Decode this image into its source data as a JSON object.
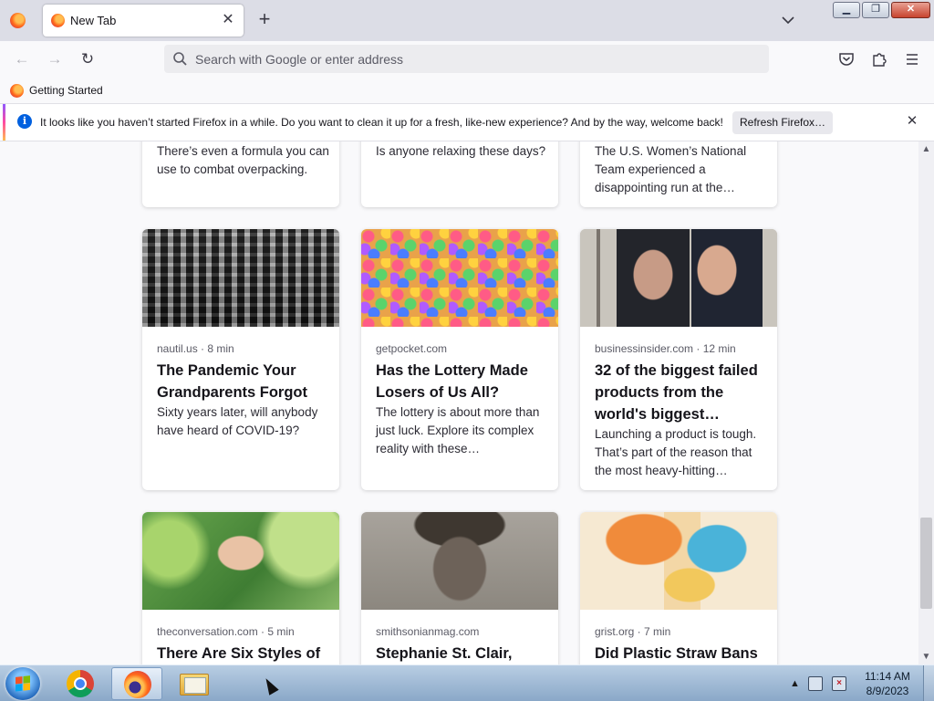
{
  "tab": {
    "title": "New Tab",
    "close": "✕"
  },
  "tabstrip": {
    "new_tab": "+"
  },
  "window_controls": {
    "minimize": "▁",
    "restore": "❐",
    "close": "✕"
  },
  "navbar": {
    "back": "←",
    "forward": "→",
    "reload": "↻",
    "url_placeholder": "Search with Google or enter address"
  },
  "bookmarks": [
    {
      "label": "Getting Started"
    }
  ],
  "notification": {
    "info": "i",
    "message": "It looks like you haven’t started Firefox in a while. Do you want to clean it up for a fresh, like-new experience? And by the way, welcome back!",
    "button": "Refresh Firefox…",
    "close": "✕"
  },
  "stories_partial": [
    {
      "excerpt": "There’s even a formula you can use to combat overpacking."
    },
    {
      "excerpt": "Is anyone relaxing these days?"
    },
    {
      "excerpt": "The U.S. Women’s National Team experienced a disappointing run at the…"
    }
  ],
  "stories_row2": [
    {
      "source": "nautil.us · 8 min",
      "title": "The Pandemic Your Grandparents Forgot",
      "excerpt": "Sixty years later, will anybody have heard of COVID-19?"
    },
    {
      "source": "getpocket.com",
      "title": "Has the Lottery Made Losers of Us All?",
      "excerpt": "The lottery is about more than just luck. Explore its complex reality with these…"
    },
    {
      "source": "businessinsider.com · 12 min",
      "title": "32 of the biggest failed products from the world's biggest…",
      "excerpt": "Launching a product is tough. That’s part of the reason that the most heavy-hitting…"
    }
  ],
  "stories_row3": [
    {
      "source": "theconversation.com · 5 min",
      "title": "There Are Six Styles of"
    },
    {
      "source": "smithsonianmag.com",
      "title": "Stephanie St. Clair,"
    },
    {
      "source": "grist.org · 7 min",
      "title": "Did Plastic Straw Bans"
    }
  ],
  "scrollbar": {
    "up": "▲",
    "down": "▼"
  },
  "taskbar": {
    "tray_expand": "▲",
    "time": "11:14 AM",
    "date": "8/9/2023"
  }
}
